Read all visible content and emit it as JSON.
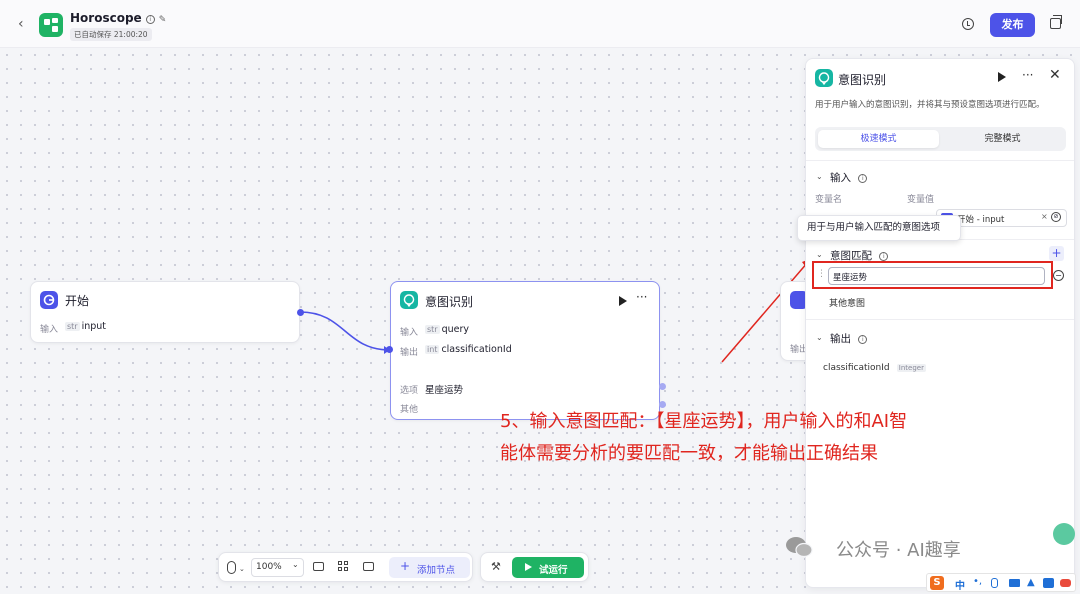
{
  "header": {
    "app_title": "Horoscope",
    "autosave": "已自动保存 21:00:20",
    "publish_label": "发布"
  },
  "nodes": {
    "start": {
      "title": "开始",
      "input_label": "输入",
      "input_type": "str",
      "input_name": "input"
    },
    "intent": {
      "title": "意图识别",
      "input_label": "输入",
      "input_type": "str",
      "input_name": "query",
      "output_label": "输出",
      "output_type": "int",
      "output_name": "classificationId",
      "option_label": "选项",
      "option_value": "星座运势",
      "other_label": "其他"
    },
    "partial_output_label": "输出"
  },
  "panel": {
    "title": "意图识别",
    "description": "用于用户输入的意图识别，并将其与预设意图选项进行匹配。",
    "tab_fast": "极速模式",
    "tab_full": "完整模式",
    "input_section": "输入",
    "col_var_name": "变量名",
    "col_var_value": "变量值",
    "input_ref": "开始 - input",
    "tooltip": "用于与用户输入匹配的意图选项",
    "match_section": "意图匹配",
    "intent_option_value": "星座运势",
    "other_intent": "其他意图",
    "output_section": "输出",
    "output_name": "classificationId",
    "output_type": "Integer"
  },
  "toolbar": {
    "zoom": "100%",
    "add_node": "添加节点",
    "test_run": "试运行"
  },
  "annotation": {
    "line1": "5、输入意图匹配：【星座运势】，用户输入的和AI智",
    "line2": "能体需要分析的要匹配一致，才能输出正确结果"
  },
  "watermark": "公众号 · AI趣享",
  "ime": {
    "lang": "中"
  },
  "colors": {
    "accent": "#4d53e8",
    "intent_node": "#16b6a3",
    "start_node": "#4d53e8",
    "annotation": "#e0261f",
    "logo": "#1fb364"
  }
}
